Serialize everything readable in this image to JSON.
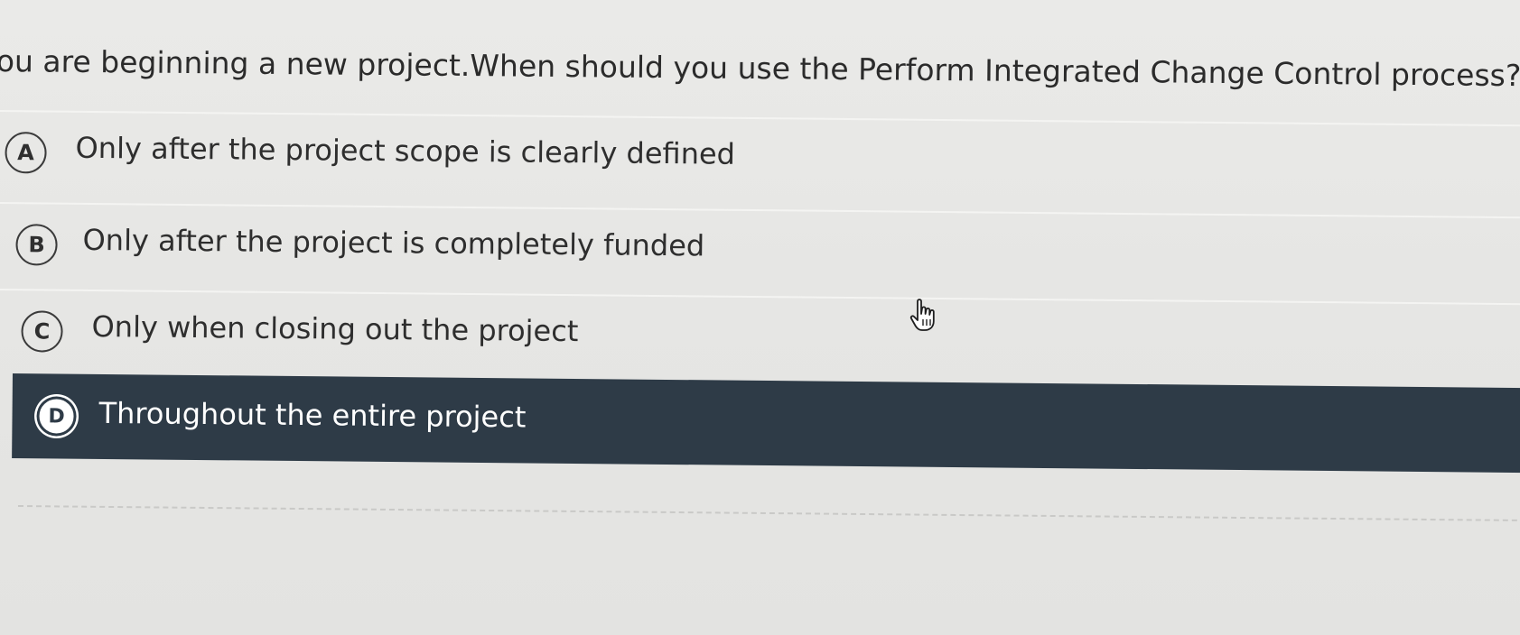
{
  "question": {
    "text": "ou are beginning a new project.When should you use the Perform Integrated Change Control process?"
  },
  "options": [
    {
      "letter": "A",
      "text": "Only after the project scope is clearly defined",
      "selected": false
    },
    {
      "letter": "B",
      "text": "Only after the project is completely funded",
      "selected": false
    },
    {
      "letter": "C",
      "text": "Only when closing out the project",
      "selected": false
    },
    {
      "letter": "D",
      "text": "Throughout the entire project",
      "selected": true
    }
  ],
  "colors": {
    "selected_background": "#2e3b47",
    "page_background": "#e9e9e7",
    "text": "#2e2e2e"
  },
  "icons": {
    "cursor": "hand-pointer-icon"
  }
}
